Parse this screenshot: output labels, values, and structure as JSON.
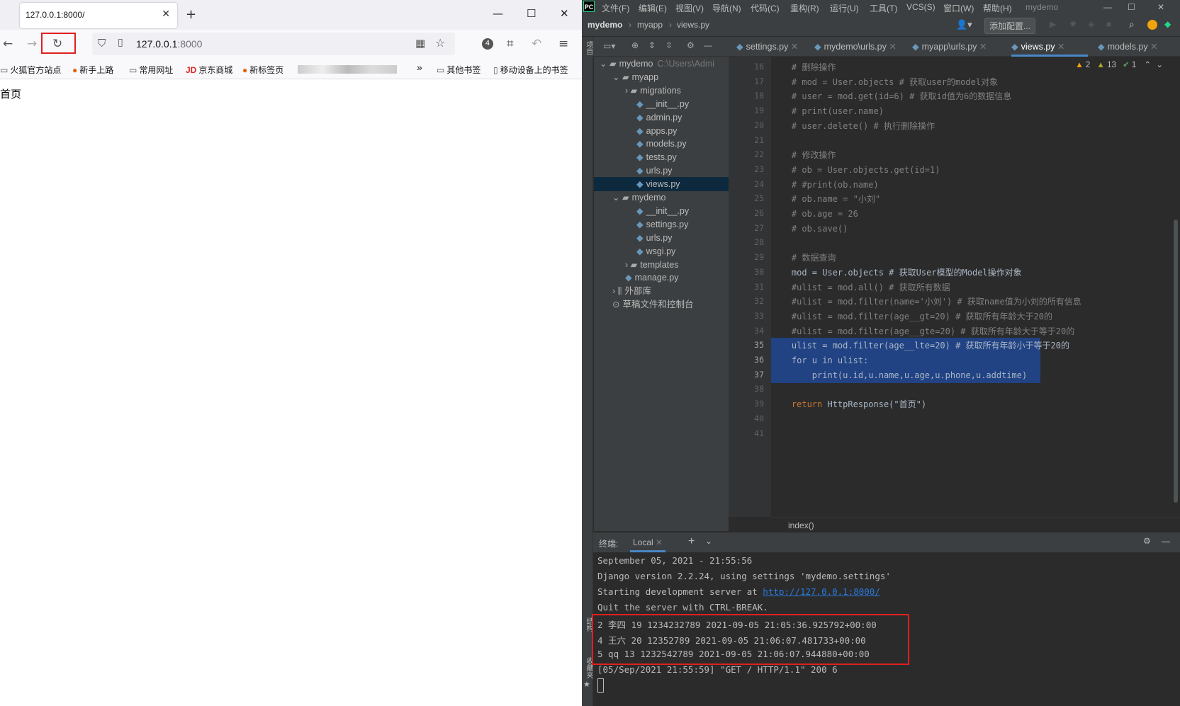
{
  "browser": {
    "tab_title": "127.0.0.1:8000/",
    "url_host": "127.0.0.1",
    "url_port": ":8000",
    "extensions_badge": "4",
    "bookmarks": [
      "火狐官方站点",
      "新手上路",
      "常用网址",
      "京东商城",
      "新标签页",
      "其他书签",
      "移动设备上的书签"
    ],
    "page_text": "首页"
  },
  "ide": {
    "menus": [
      "文件(F)",
      "编辑(E)",
      "视图(V)",
      "导航(N)",
      "代码(C)",
      "重构(R)",
      "运行(U)",
      "工具(T)",
      "VCS(S)",
      "窗口(W)",
      "帮助(H)"
    ],
    "project_title": "mydemo",
    "breadcrumb": [
      "mydemo",
      "myapp",
      "views.py"
    ],
    "add_config": "添加配置...",
    "tabs": [
      "settings.py",
      "mydemo\\urls.py",
      "myapp\\urls.py",
      "views.py",
      "models.py"
    ],
    "active_tab": "views.py",
    "tree": [
      {
        "label": "mydemo",
        "extra": "C:\\Users\\Admi",
        "depth": 0,
        "type": "folder"
      },
      {
        "label": "myapp",
        "depth": 1,
        "type": "folder"
      },
      {
        "label": "migrations",
        "depth": 2,
        "type": "folder"
      },
      {
        "label": "__init__.py",
        "depth": 3,
        "type": "file"
      },
      {
        "label": "admin.py",
        "depth": 3,
        "type": "file"
      },
      {
        "label": "apps.py",
        "depth": 3,
        "type": "file"
      },
      {
        "label": "models.py",
        "depth": 3,
        "type": "file"
      },
      {
        "label": "tests.py",
        "depth": 3,
        "type": "file"
      },
      {
        "label": "urls.py",
        "depth": 3,
        "type": "file"
      },
      {
        "label": "views.py",
        "depth": 3,
        "type": "file",
        "selected": true
      },
      {
        "label": "mydemo",
        "depth": 1,
        "type": "folder"
      },
      {
        "label": "__init__.py",
        "depth": 3,
        "type": "file"
      },
      {
        "label": "settings.py",
        "depth": 3,
        "type": "file"
      },
      {
        "label": "urls.py",
        "depth": 3,
        "type": "file"
      },
      {
        "label": "wsgi.py",
        "depth": 3,
        "type": "file"
      },
      {
        "label": "templates",
        "depth": 2,
        "type": "folder"
      },
      {
        "label": "manage.py",
        "depth": 2,
        "type": "file"
      },
      {
        "label": "外部库",
        "depth": 1,
        "type": "lib"
      },
      {
        "label": "草稿文件和控制台",
        "depth": 1,
        "type": "scratch"
      }
    ],
    "warnings": {
      "warn1": "2",
      "warn2": "13",
      "ok": "1"
    },
    "code_lines": [
      {
        "n": "16",
        "t": "# 删除操作",
        "c": "cm"
      },
      {
        "n": "17",
        "t": "# mod = User.objects # 获取user的model对象",
        "c": "cm"
      },
      {
        "n": "18",
        "t": "# user = mod.get(id=6) # 获取id值为6的数据信息",
        "c": "cm"
      },
      {
        "n": "19",
        "t": "# print(user.name)",
        "c": "cm"
      },
      {
        "n": "20",
        "t": "# user.delete() # 执行删除操作",
        "c": "cm"
      },
      {
        "n": "21",
        "t": "",
        "c": ""
      },
      {
        "n": "22",
        "t": "# 修改操作",
        "c": "cm"
      },
      {
        "n": "23",
        "t": "# ob = User.objects.get(id=1)",
        "c": "cm"
      },
      {
        "n": "24",
        "t": "# #print(ob.name)",
        "c": "cm"
      },
      {
        "n": "25",
        "t": "# ob.name = \"小刘\"",
        "c": "cm"
      },
      {
        "n": "26",
        "t": "# ob.age = 26",
        "c": "cm"
      },
      {
        "n": "27",
        "t": "# ob.save()",
        "c": "cm"
      },
      {
        "n": "28",
        "t": "",
        "c": ""
      },
      {
        "n": "29",
        "t": "# 数据查询",
        "c": "cm"
      },
      {
        "n": "30",
        "t": "mod = User.objects # 获取User模型的Model操作对象",
        "c": ""
      },
      {
        "n": "31",
        "t": "#ulist = mod.all() # 获取所有数据",
        "c": "cm"
      },
      {
        "n": "32",
        "t": "#ulist = mod.filter(name='小刘') # 获取name值为小刘的所有信息",
        "c": "cm"
      },
      {
        "n": "33",
        "t": "#ulist = mod.filter(age__gt=20) # 获取所有年龄大于20的",
        "c": "cm"
      },
      {
        "n": "34",
        "t": "#ulist = mod.filter(age__gte=20) # 获取所有年龄大于等于20的",
        "c": "cm"
      },
      {
        "n": "35",
        "t": "ulist = mod.filter(age__lte=20) # 获取所有年龄小于等于20的",
        "c": "sel"
      },
      {
        "n": "36",
        "t": "for u in ulist:",
        "c": "sel"
      },
      {
        "n": "37",
        "t": "    print(u.id,u.name,u.age,u.phone,u.addtime)",
        "c": "sel"
      },
      {
        "n": "38",
        "t": "",
        "c": ""
      },
      {
        "n": "39",
        "t": "return HttpResponse(\"首页\")",
        "c": "ret"
      },
      {
        "n": "40",
        "t": "",
        "c": ""
      },
      {
        "n": "41",
        "t": "",
        "c": ""
      }
    ],
    "function_crumb": "index()",
    "terminal": {
      "label": "终端:",
      "tab": "Local",
      "lines": [
        "September 05, 2021 - 21:55:56",
        "Django version 2.2.24, using settings 'mydemo.settings'",
        "Starting development server at ",
        "Quit the server with CTRL-BREAK.",
        "2 李四 19 1234232789 2021-09-05 21:05:36.925792+00:00",
        "4 王六 20 12352789 2021-09-05 21:06:07.481733+00:00",
        "5 qq 13 1232542789 2021-09-05 21:06:07.944880+00:00",
        "[05/Sep/2021 21:55:59] \"GET / HTTP/1.1\" 200 6"
      ],
      "server_url": "http://127.0.0.1:8000/"
    },
    "side_labels": {
      "project": "项目",
      "structure": "结构",
      "favorites": "收藏夹"
    }
  }
}
